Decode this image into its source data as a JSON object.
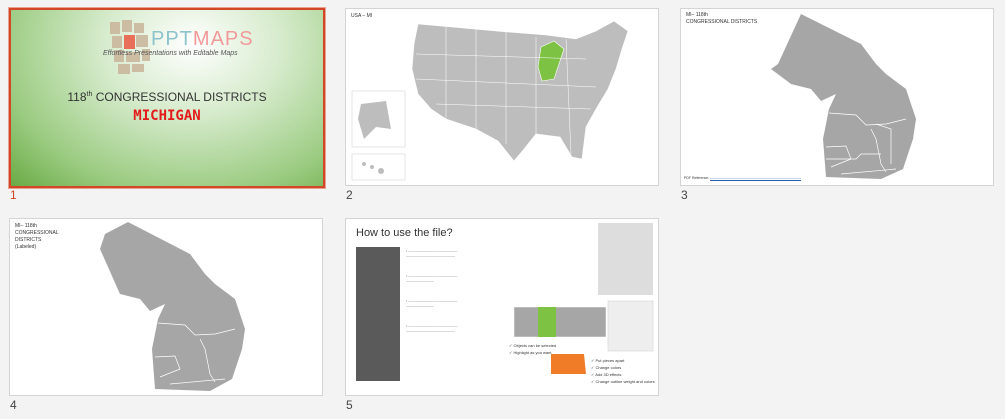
{
  "slides": [
    {
      "number": "1",
      "logo_text_a": "PPT",
      "logo_text_b": "MAPS",
      "tagline": "Effortless Presentations with Editable Maps",
      "title": "118",
      "title_sup": "th",
      "title_rest": " CONGRESSIONAL DISTRICTS",
      "subtitle": "MICHIGAN",
      "selected": true
    },
    {
      "number": "2",
      "label": "USA – MI"
    },
    {
      "number": "3",
      "label_line1": "MI– 118th",
      "label_line2": "CONGRESSIONAL DISTRICTS",
      "footer": "PDF Reference:"
    },
    {
      "number": "4",
      "label_line1": "MI– 118th",
      "label_line2": "CONGRESSIONAL",
      "label_line3": "DISTRICTS",
      "label_line4": "(Labeled)"
    },
    {
      "number": "5",
      "title": "How to use the file?",
      "checks_a": [
        "Objects can be selected",
        "Highlight as you want"
      ],
      "checks_b": [
        "Put pieces apart",
        "Change colors",
        "Add 3D effects",
        "Change outline weight and colors"
      ]
    }
  ],
  "colors": {
    "accent": "#d24726",
    "highlight": "#7dc242",
    "map": "#a6a6a6",
    "orange": "#f07c28"
  }
}
